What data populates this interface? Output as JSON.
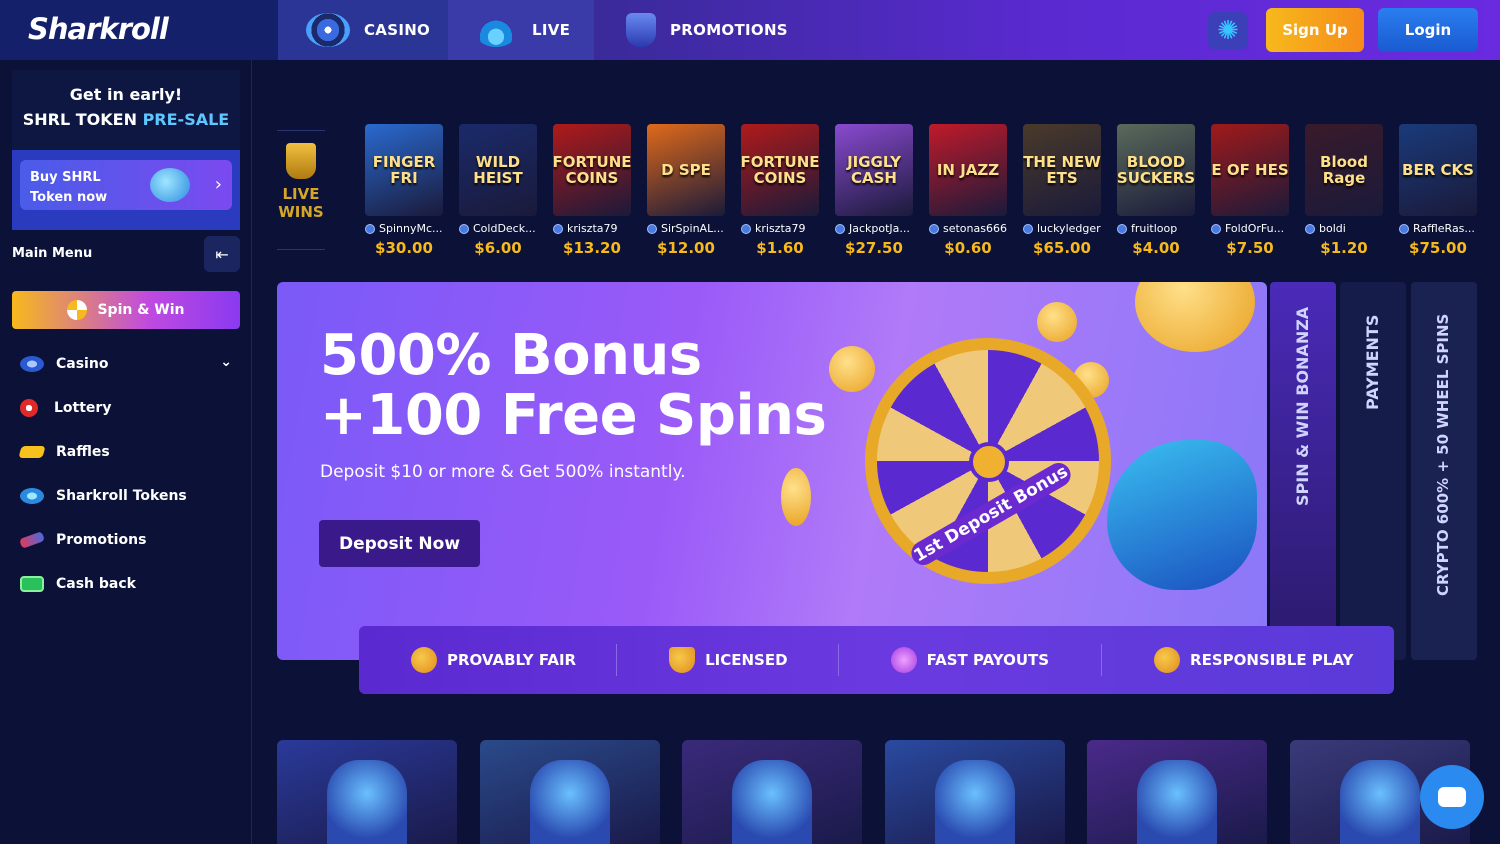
{
  "header": {
    "logo": "Sharkroll",
    "tabs": [
      {
        "label": "CASINO",
        "icon": "roulette-icon"
      },
      {
        "label": "LIVE",
        "icon": "live-icon"
      },
      {
        "label": "PROMOTIONS",
        "icon": "trophy-icon"
      }
    ],
    "settings_icon": "gear-icon",
    "signup_label": "Sign Up",
    "login_label": "Login"
  },
  "sidebar": {
    "presale_line1": "Get in early!",
    "presale_line2_a": "SHRL TOKEN ",
    "presale_line2_b": "PRE-SALE",
    "buy_line1": "Buy SHRL",
    "buy_line2": "Token now",
    "main_menu_label": "Main Menu",
    "spin_win_label": "Spin & Win",
    "items": [
      {
        "label": "Casino",
        "icon": "roulette-icon"
      },
      {
        "label": "Lottery",
        "icon": "lottery-ball-icon"
      },
      {
        "label": "Raffles",
        "icon": "ticket-icon"
      },
      {
        "label": "Sharkroll Tokens",
        "icon": "token-icon"
      },
      {
        "label": "Promotions",
        "icon": "megaphone-icon"
      },
      {
        "label": "Cash back",
        "icon": "cash-icon"
      }
    ]
  },
  "live_wins": {
    "label_line1": "LIVE",
    "label_line2": "WINS",
    "wins": [
      {
        "game": "FINGER FRI",
        "user": "SpinnyMc...",
        "amount": "$30.00",
        "color": "#2a6ad0"
      },
      {
        "game": "WILD HEIST",
        "user": "ColdDeck...",
        "amount": "$6.00",
        "color": "#1a2a6a"
      },
      {
        "game": "FORTUNE COINS",
        "user": "kriszta79",
        "amount": "$13.20",
        "color": "#b01a1a"
      },
      {
        "game": "D SPE",
        "user": "SirSpinAL...",
        "amount": "$12.00",
        "color": "#e06a1a"
      },
      {
        "game": "FORTUNE COINS",
        "user": "kriszta79",
        "amount": "$1.60",
        "color": "#b01a1a"
      },
      {
        "game": "JIGGLY CASH",
        "user": "JackpotJa...",
        "amount": "$27.50",
        "color": "#8a4ad0"
      },
      {
        "game": "IN JAZZ",
        "user": "setonas666",
        "amount": "$0.60",
        "color": "#c01a2a"
      },
      {
        "game": "THE NEW ETS",
        "user": "luckyledger",
        "amount": "$65.00",
        "color": "#4a3a2a"
      },
      {
        "game": "BLOOD SUCKERS",
        "user": "fruitloop",
        "amount": "$4.00",
        "color": "#5a6a5a"
      },
      {
        "game": "E OF HES",
        "user": "FoldOrFu...",
        "amount": "$7.50",
        "color": "#a01a1a"
      },
      {
        "game": "Blood Rage",
        "user": "boldi",
        "amount": "$1.20",
        "color": "#3a1a2a"
      },
      {
        "game": "BER CKS",
        "user": "RaffleRas...",
        "amount": "$75.00",
        "color": "#1a3a7a"
      }
    ]
  },
  "hero": {
    "title_line1": "500% Bonus",
    "title_line2": "+100 Free Spins",
    "subtitle": "Deposit $10 or more & Get 500% instantly.",
    "cta": "Deposit Now",
    "wheel_label": "1st Deposit Bonus"
  },
  "side_tabs": [
    "SPIN & WIN BONANZA",
    "PAYMENTS",
    "CRYPTO 600% + 50 WHEEL SPINS"
  ],
  "trust": [
    {
      "label": "PROVABLY FAIR",
      "icon": "check-badge-icon"
    },
    {
      "label": "LICENSED",
      "icon": "shield-check-icon"
    },
    {
      "label": "FAST PAYOUTS",
      "icon": "lightning-icon"
    },
    {
      "label": "RESPONSIBLE PLAY",
      "icon": "heart-icon"
    }
  ],
  "cards": [
    {
      "icon": "poker-chips-icon",
      "color": "#2a3a9a"
    },
    {
      "icon": "shark-live-icon",
      "color": "#2a4a8a"
    },
    {
      "icon": "shark-surf-icon",
      "color": "#3a2a7a"
    },
    {
      "icon": "shark-dice-icon",
      "color": "#2a4aa0"
    },
    {
      "icon": "cards-icon",
      "color": "#4a2a8a"
    },
    {
      "icon": "lottery-balls-icon",
      "color": "#3a3a7a"
    }
  ],
  "chat_icon": "chat-icon"
}
